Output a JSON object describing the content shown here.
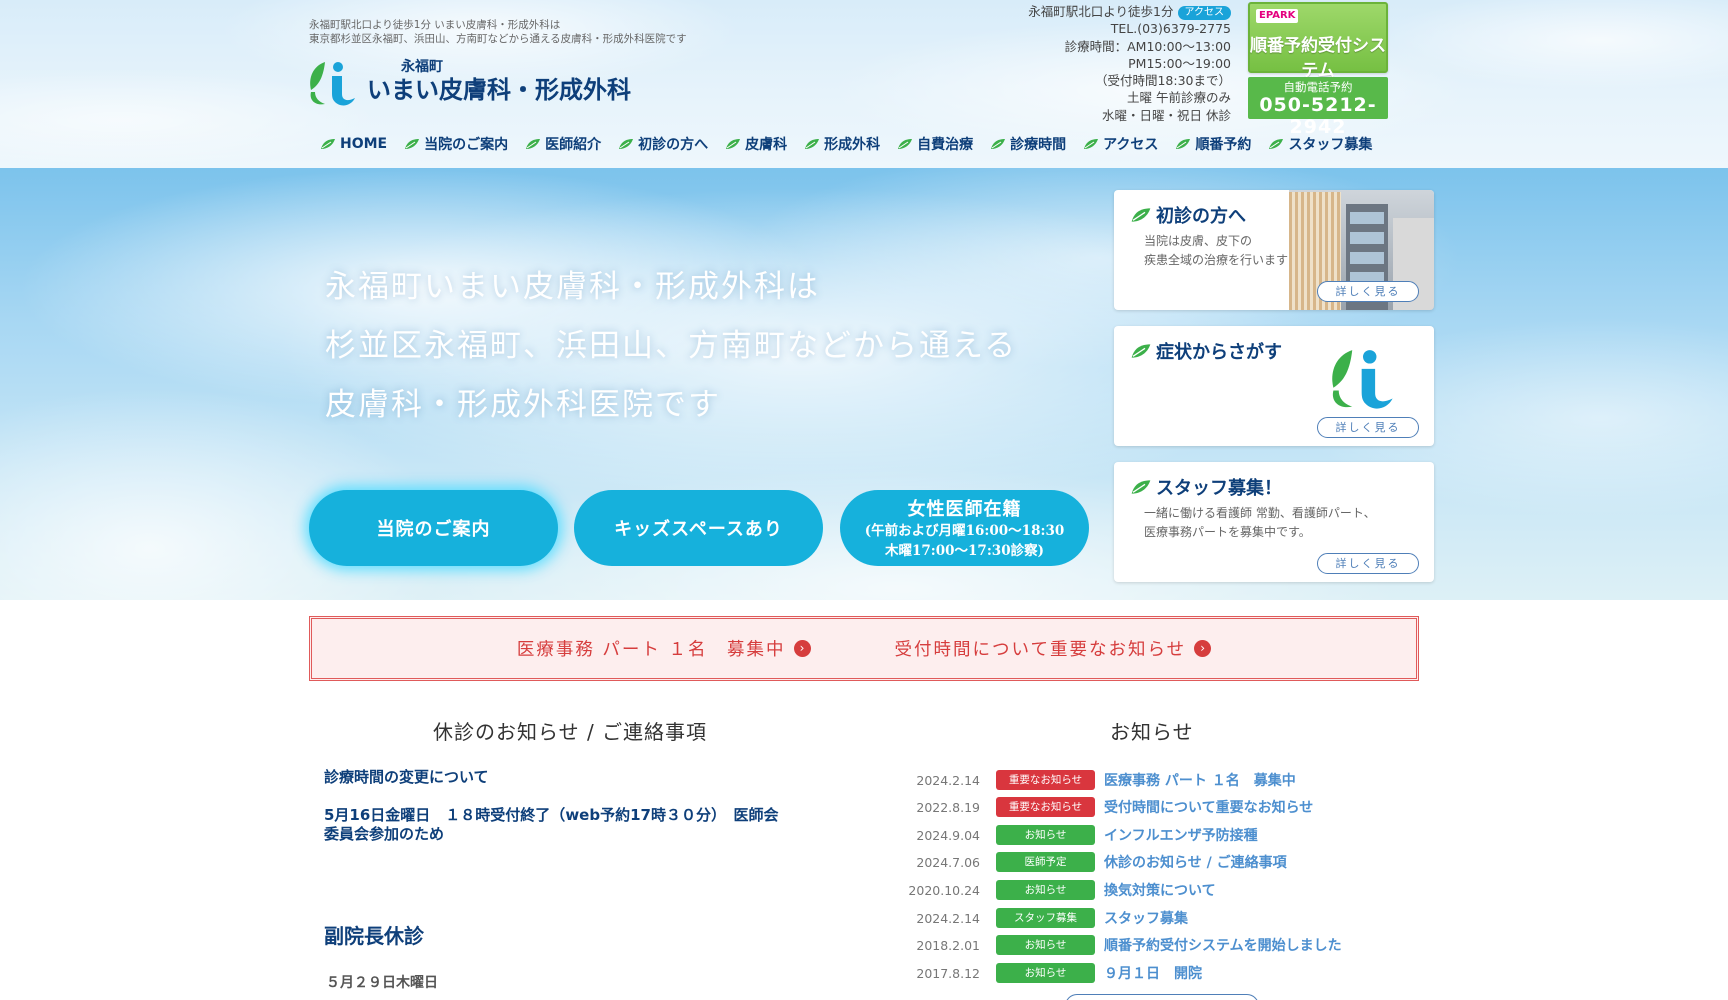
{
  "header": {
    "tagline_line1": "永福町駅北口より徒歩1分 いまい皮膚科・形成外科は",
    "tagline_line2": "東京都杉並区永福町、浜田山、方南町などから通える皮膚科・形成外科医院です",
    "logo_small": "永福町",
    "logo_big": "いまい皮膚科・形成外科",
    "info": {
      "station": "永福町駅北口より徒歩1分",
      "access_badge": "アクセス",
      "tel": "TEL.(03)6379-2775",
      "hours_am": "診療時間：AM10:00～13:00",
      "hours_pm": "PM15:00～19:00",
      "reception": "（受付時間18:30まで）",
      "saturday": "土曜 午前診療のみ",
      "closed": "水曜・日曜・祝日 休診"
    },
    "reserve_button": {
      "epark": "EPARK",
      "label": "順番予約受付システム"
    },
    "phone": {
      "label": "自動電話予約",
      "number": "050-5212-2942"
    },
    "nav": [
      "HOME",
      "当院のご案内",
      "医師紹介",
      "初診の方へ",
      "皮膚科",
      "形成外科",
      "自費治療",
      "診療時間",
      "アクセス",
      "順番予約",
      "スタッフ募集"
    ]
  },
  "hero": {
    "copy_line1": "永福町いまい皮膚科・形成外科は",
    "copy_line2": "杉並区永福町、浜田山、方南町などから通える",
    "copy_line3": "皮膚科・形成外科医院です",
    "pills": {
      "about": "当院のご案内",
      "kids": "キッズスペースあり",
      "female_title": "女性医師在籍",
      "female_sub1": "(午前および月曜16:00～18:30",
      "female_sub2": "木曜17:00～17:30診察)"
    },
    "cards": {
      "first": {
        "title": "初診の方へ",
        "text1": "当院は皮膚、皮下の",
        "text2": "疾患全域の治療を行います",
        "more": "詳しく見る"
      },
      "symptom": {
        "title": "症状からさがす",
        "more": "詳しく見る"
      },
      "staff": {
        "title": "スタッフ募集！",
        "text1": "一緒に働ける看護師 常勤、看護師パート、",
        "text2": "医療事務パートを募集中です。",
        "more": "詳しく見る"
      }
    }
  },
  "notice": {
    "link1": "医療事務 パート １名　募集中",
    "link2": "受付時間について重要なお知らせ"
  },
  "closure": {
    "title": "休診のお知らせ / ご連絡事項",
    "item1": "診療時間の変更について",
    "item2_line1": "5月16日金曜日　１８時受付終了（web予約17時３０分）　医師会",
    "item2_line2": "委員会参加のため",
    "item3": "副院長休診",
    "item4": "５月２９日木曜日"
  },
  "news": {
    "title": "お知らせ",
    "items": [
      {
        "date": "2024.2.14",
        "badge": "重要なお知らせ",
        "title": "医療事務 パート １名　募集中"
      },
      {
        "date": "2022.8.19",
        "badge": "重要なお知らせ",
        "title": "受付時間について重要なお知らせ"
      },
      {
        "date": "2024.9.04",
        "badge": "お知らせ",
        "title": "インフルエンザ予防接種"
      },
      {
        "date": "2024.7.06",
        "badge": "医師予定",
        "title": "休診のお知らせ / ご連絡事項"
      },
      {
        "date": "2020.10.24",
        "badge": "お知らせ",
        "title": "換気対策について"
      },
      {
        "date": "2024.2.14",
        "badge": "スタッフ募集",
        "title": "スタッフ募集"
      },
      {
        "date": "2018.2.01",
        "badge": "お知らせ",
        "title": "順番予約受付システムを開始しました"
      },
      {
        "date": "2017.8.12",
        "badge": "お知らせ",
        "title": "９月１日　開院"
      }
    ]
  },
  "colors": {
    "navy": "#0e3f7a",
    "accent_blue": "#16b1dc",
    "green": "#58b94a",
    "important_red": "#d9363e",
    "notice_red": "#d63d3d",
    "link_blue": "#4d8fcf"
  },
  "icons": [
    "leaf-icon",
    "logo-mark",
    "arrow-right-circle-icon"
  ]
}
